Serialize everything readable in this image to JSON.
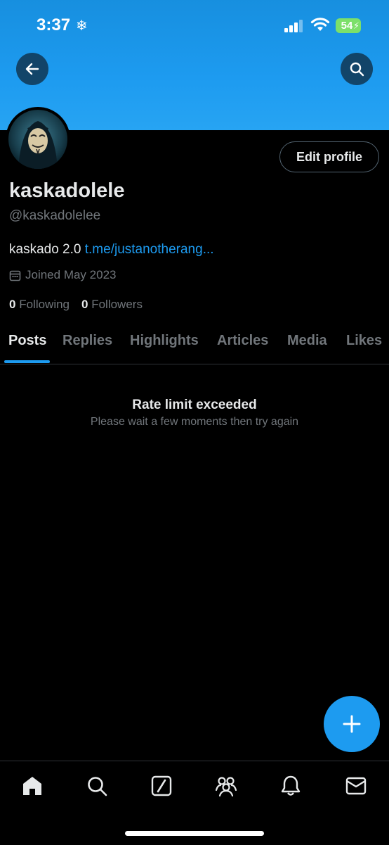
{
  "status_bar": {
    "time": "3:37",
    "battery": "54"
  },
  "profile": {
    "display_name": "kaskadolele",
    "handle": "@kaskadolelee",
    "bio_text": "kaskado 2.0",
    "bio_link": "t.me/justanotherang...",
    "joined": "Joined May 2023",
    "following_count": "0",
    "following_label": "Following",
    "followers_count": "0",
    "followers_label": "Followers",
    "edit_label": "Edit profile"
  },
  "tabs": [
    {
      "label": "Posts",
      "active": true
    },
    {
      "label": "Replies"
    },
    {
      "label": "Highlights"
    },
    {
      "label": "Articles"
    },
    {
      "label": "Media"
    },
    {
      "label": "Likes"
    }
  ],
  "error": {
    "title": "Rate limit exceeded",
    "message": "Please wait a few moments then try again"
  },
  "bottom_nav": [
    "home-icon",
    "search-icon",
    "grok-icon",
    "communities-icon",
    "notifications-icon",
    "messages-icon"
  ],
  "colors": {
    "accent": "#1d9bf0",
    "banner": "#1d9bf0",
    "muted": "#71767b",
    "battery": "#7ce06a"
  }
}
